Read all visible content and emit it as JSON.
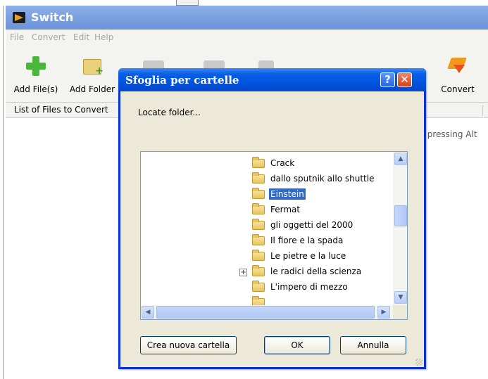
{
  "app": {
    "title": "Switch",
    "menu": [
      "File",
      "Convert",
      "Edit",
      "Help"
    ],
    "toolbar": {
      "add_files": "Add File(s)",
      "add_folder": "Add Folder",
      "convert": "Convert"
    },
    "list_header": "List of Files to Convert",
    "hint": "r pressing Alt"
  },
  "dialog": {
    "title": "Sfoglia per cartelle",
    "help_label": "?",
    "close_label": "✕",
    "caption": "Locate folder...",
    "folders": [
      {
        "name": "Crack",
        "selected": false
      },
      {
        "name": "dallo sputnik allo shuttle",
        "selected": false
      },
      {
        "name": "Einstein",
        "selected": true
      },
      {
        "name": "Fermat",
        "selected": false
      },
      {
        "name": "gli oggetti del 2000",
        "selected": false
      },
      {
        "name": "Il fiore e la spada",
        "selected": false
      },
      {
        "name": "Le pietre e la luce",
        "selected": false
      },
      {
        "name": "le radici della scienza",
        "selected": false,
        "expandable": true
      },
      {
        "name": "L'impero di mezzo",
        "selected": false
      }
    ],
    "buttons": {
      "new_folder": "Crea nuova cartella",
      "ok": "OK",
      "cancel": "Annulla"
    }
  },
  "colors": {
    "dialog_title_bar": "#0052dd",
    "selection": "#316ac5",
    "app_title_bar": "#7a9fe0"
  }
}
